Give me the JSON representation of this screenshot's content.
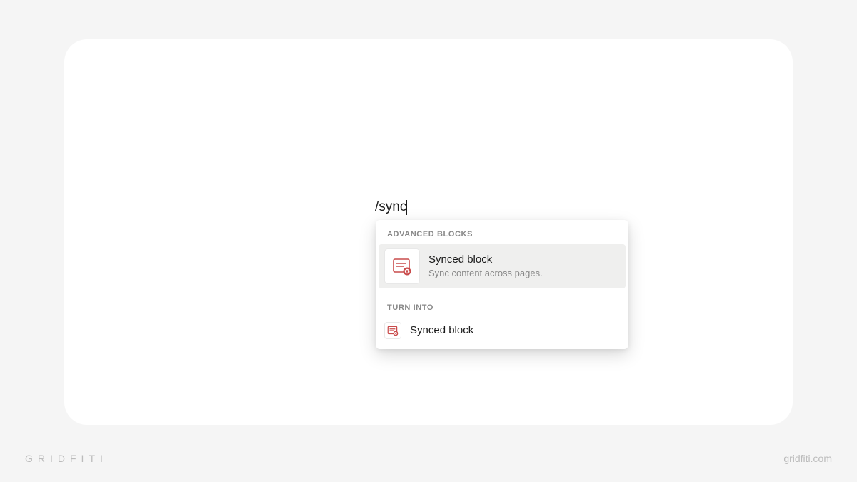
{
  "editor": {
    "slash_input": "/sync"
  },
  "dropdown": {
    "sections": [
      {
        "header": "ADVANCED BLOCKS",
        "items": [
          {
            "title": "Synced block",
            "subtitle": "Sync content across pages."
          }
        ]
      },
      {
        "header": "TURN INTO",
        "items": [
          {
            "title": "Synced block"
          }
        ]
      }
    ]
  },
  "footer": {
    "brand": "GRIDFITI",
    "url": "gridfiti.com"
  }
}
